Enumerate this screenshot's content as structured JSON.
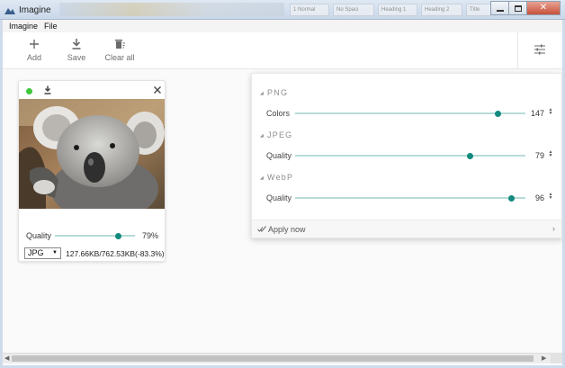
{
  "window": {
    "title": "Imagine",
    "bg_tabs": [
      "1 Normal",
      "No Spaci",
      "Heading 1",
      "Heading 2",
      "Title"
    ]
  },
  "menu": {
    "items": [
      "Imagine",
      "File"
    ]
  },
  "toolbar": {
    "add_label": "Add",
    "save_label": "Save",
    "clear_label": "Clear all"
  },
  "card": {
    "status_color": "#3ec73e",
    "quality_label": "Quality",
    "quality_value": "79%",
    "quality_fraction": 0.79,
    "format": "JPG",
    "size_text": "127.66KB/762.53KB(-83.3%)"
  },
  "panel": {
    "png": {
      "header": "PNG",
      "label": "Colors",
      "value": "147",
      "fraction": 0.88
    },
    "jpeg": {
      "header": "JPEG",
      "label": "Quality",
      "value": "79",
      "fraction": 0.76
    },
    "webp": {
      "header": "WebP",
      "label": "Quality",
      "value": "96",
      "fraction": 0.94
    },
    "apply_label": "Apply now"
  },
  "colors": {
    "accent": "#138a7e",
    "track": "#b7dcd8"
  },
  "icons": [
    "plus-icon",
    "download-icon",
    "trash-icon",
    "tune-icon",
    "close-icon",
    "check-icon",
    "chevron-right-icon"
  ]
}
